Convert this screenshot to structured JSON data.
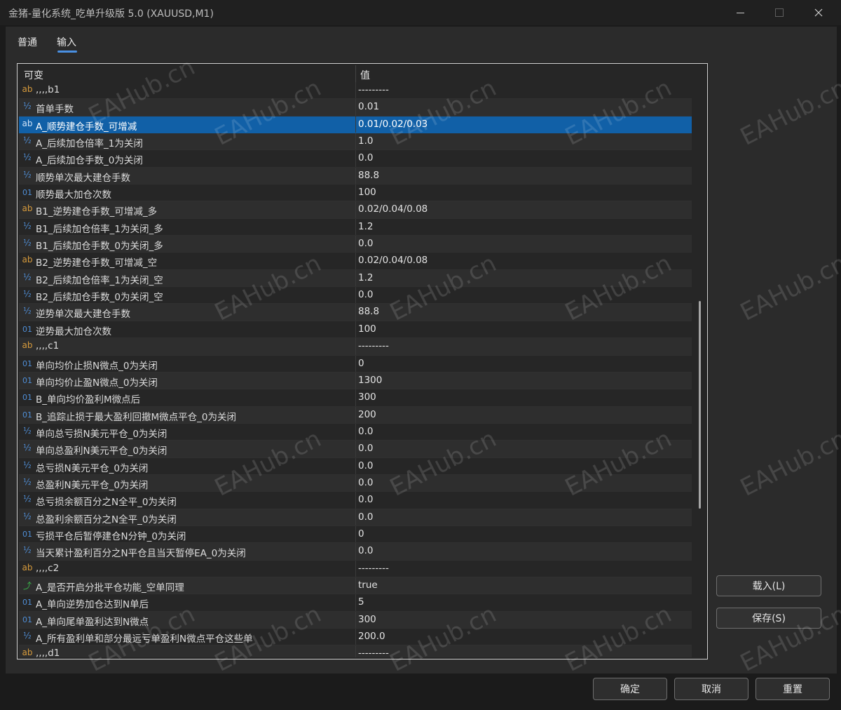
{
  "window": {
    "title": "金猪-量化系统_吃单升级版 5.0 (XAUUSD,M1)"
  },
  "tabs": [
    {
      "label": "普通"
    },
    {
      "label": "输入"
    }
  ],
  "grid": {
    "headers": {
      "variable": "可变",
      "value": "值"
    },
    "rows": [
      {
        "type": "ab",
        "name": ",,,,b1",
        "value": "---------"
      },
      {
        "type": "dbl",
        "name": "首单手数",
        "value": "0.01"
      },
      {
        "type": "ab",
        "name": "A_顺势建仓手数_可增减",
        "value": "0.01/0.02/0.03",
        "selected": true
      },
      {
        "type": "dbl",
        "name": "A_后续加仓倍率_1为关闭",
        "value": "1.0"
      },
      {
        "type": "dbl",
        "name": "A_后续加仓手数_0为关闭",
        "value": "0.0"
      },
      {
        "type": "dbl",
        "name": "顺势单次最大建仓手数",
        "value": "88.8"
      },
      {
        "type": "int",
        "name": "顺势最大加仓次数",
        "value": "100"
      },
      {
        "type": "ab",
        "name": "B1_逆势建仓手数_可增减_多",
        "value": "0.02/0.04/0.08"
      },
      {
        "type": "dbl",
        "name": "B1_后续加仓倍率_1为关闭_多",
        "value": "1.2"
      },
      {
        "type": "dbl",
        "name": "B1_后续加仓手数_0为关闭_多",
        "value": "0.0"
      },
      {
        "type": "ab",
        "name": "B2_逆势建仓手数_可增减_空",
        "value": "0.02/0.04/0.08"
      },
      {
        "type": "dbl",
        "name": "B2_后续加仓倍率_1为关闭_空",
        "value": "1.2"
      },
      {
        "type": "dbl",
        "name": "B2_后续加仓手数_0为关闭_空",
        "value": "0.0"
      },
      {
        "type": "dbl",
        "name": "逆势单次最大建仓手数",
        "value": "88.8"
      },
      {
        "type": "int",
        "name": "逆势最大加仓次数",
        "value": "100"
      },
      {
        "type": "ab",
        "name": ",,,,c1",
        "value": "---------"
      },
      {
        "type": "int",
        "name": "单向均价止损N微点_0为关闭",
        "value": "0"
      },
      {
        "type": "int",
        "name": "单向均价止盈N微点_0为关闭",
        "value": "1300"
      },
      {
        "type": "int",
        "name": "B_单向均价盈利M微点后",
        "value": "300"
      },
      {
        "type": "int",
        "name": "B_追踪止损于最大盈利回撤M微点平仓_0为关闭",
        "value": "200"
      },
      {
        "type": "dbl",
        "name": "单向总亏损N美元平仓_0为关闭",
        "value": "0.0"
      },
      {
        "type": "dbl",
        "name": "单向总盈利N美元平仓_0为关闭",
        "value": "0.0"
      },
      {
        "type": "dbl",
        "name": "总亏损N美元平仓_0为关闭",
        "value": "0.0"
      },
      {
        "type": "dbl",
        "name": "总盈利N美元平仓_0为关闭",
        "value": "0.0"
      },
      {
        "type": "dbl",
        "name": "总亏损余额百分之N全平_0为关闭",
        "value": "0.0"
      },
      {
        "type": "dbl",
        "name": "总盈利余额百分之N全平_0为关闭",
        "value": "0.0"
      },
      {
        "type": "int",
        "name": "亏损平仓后暂停建仓N分钟_0为关闭",
        "value": "0"
      },
      {
        "type": "dbl",
        "name": "当天累计盈利百分之N平仓且当天暂停EA_0为关闭",
        "value": "0.0"
      },
      {
        "type": "ab",
        "name": ",,,,c2",
        "value": "---------"
      },
      {
        "type": "bool",
        "name": "A_是否开启分批平仓功能_空单同理",
        "value": "true"
      },
      {
        "type": "int",
        "name": "A_单向逆势加仓达到N单后",
        "value": "5"
      },
      {
        "type": "int",
        "name": "A_单向尾单盈利达到N微点",
        "value": "300"
      },
      {
        "type": "dbl",
        "name": "A_所有盈利单和部分最远亏单盈利N微点平仓这些单",
        "value": "200.0"
      },
      {
        "type": "ab",
        "name": ",,,,d1",
        "value": "---------"
      }
    ]
  },
  "type_glyphs": {
    "ab": "ab",
    "dbl": "½",
    "int": "01",
    "bool": "⤴"
  },
  "side_buttons": {
    "load": "载入(L)",
    "save": "保存(S)"
  },
  "footer": {
    "ok": "确定",
    "cancel": "取消",
    "reset": "重置"
  },
  "watermark": "EAHub.cn",
  "colors": {
    "selection": "#1160a7",
    "tab_accent": "#4a90e2",
    "icon_string": "#d69a3c",
    "icon_number": "#4f8ed6",
    "icon_bool": "#39b54a"
  }
}
